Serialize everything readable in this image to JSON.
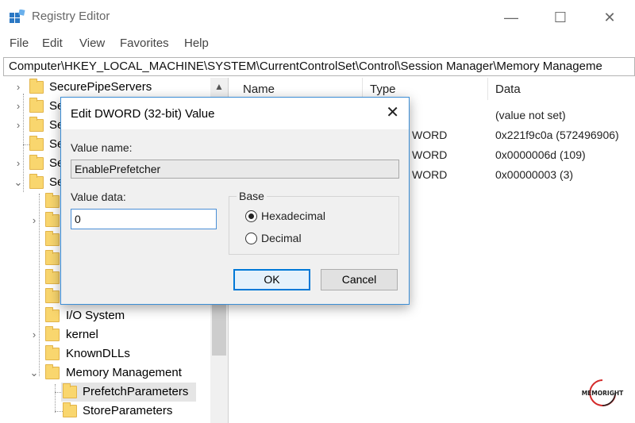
{
  "window": {
    "title": "Registry Editor"
  },
  "menu": [
    "File",
    "Edit",
    "View",
    "Favorites",
    "Help"
  ],
  "address": "Computer\\HKEY_LOCAL_MACHINE\\SYSTEM\\CurrentControlSet\\Control\\Session Manager\\Memory Manageme",
  "tree": {
    "items": [
      {
        "label": "SecurePipeServers"
      },
      {
        "label": "Se"
      },
      {
        "label": "Se"
      },
      {
        "label": "Se"
      },
      {
        "label": "Se"
      },
      {
        "label": "Se"
      },
      {
        "label": "I/O System"
      },
      {
        "label": "kernel"
      },
      {
        "label": "KnownDLLs"
      },
      {
        "label": "Memory Management"
      },
      {
        "label": "PrefetchParameters"
      },
      {
        "label": "StoreParameters"
      }
    ]
  },
  "list": {
    "columns": {
      "name": "Name",
      "type": "Type",
      "data": "Data"
    },
    "rows": [
      {
        "type": "",
        "data": "(value not set)"
      },
      {
        "type": "WORD",
        "data": "0x221f9c0a (572496906)"
      },
      {
        "type": "WORD",
        "data": "0x0000006d (109)"
      },
      {
        "type": "WORD",
        "data": "0x00000003 (3)"
      }
    ]
  },
  "dialog": {
    "title": "Edit DWORD (32-bit) Value",
    "close_glyph": "✕",
    "value_name_label": "Value name:",
    "value_name": "EnablePrefetcher",
    "value_data_label": "Value data:",
    "value_data": "0",
    "base_label": "Base",
    "radio_hex": "Hexadecimal",
    "radio_dec": "Decimal",
    "ok": "OK",
    "cancel": "Cancel"
  },
  "watermark": {
    "text": "MEMORIGHT"
  },
  "colors": {
    "accent": "#0078d7",
    "folder": "#f9d66e",
    "dialog_border": "#3c8ed6"
  },
  "icons": [
    "registry-app-icon",
    "minimize-icon",
    "maximize-icon",
    "close-icon",
    "folder-icon",
    "chevron-right-icon",
    "chevron-down-icon",
    "scroll-up-icon"
  ]
}
